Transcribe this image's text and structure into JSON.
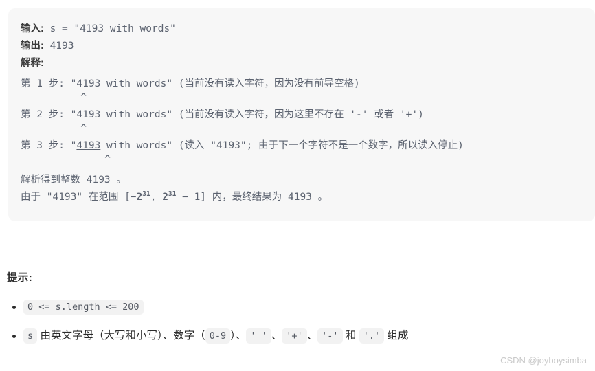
{
  "example": {
    "input_label": "输入:",
    "input_value": "s = \"4193 with words\"",
    "output_label": "输出:",
    "output_value": "4193",
    "explain_label": "解释:",
    "steps": [
      {
        "prefix": "第 1 步: \"",
        "highlight": "4193",
        "underlined": false,
        "suffix": " with words\" (当前没有读入字符，因为没有前导空格)",
        "caret": "          ^"
      },
      {
        "prefix": "第 2 步: \"",
        "highlight": "4193",
        "underlined": false,
        "suffix": " with words\" (当前没有读入字符，因为这里不存在 '-' 或者 '+')",
        "caret": "          ^"
      },
      {
        "prefix": "第 3 步: \"",
        "highlight": "4193",
        "underlined": true,
        "suffix": " with words\" (读入 \"4193\"; 由于下一个字符不是一个数字，所以读入停止)",
        "caret": "              ^"
      }
    ],
    "result_line": "解析得到整数 4193 。",
    "range_line": {
      "before": "由于 \"4193\" 在范围 [−",
      "base1": "2",
      "exp1": "31",
      "middle": ", ",
      "base2": "2",
      "exp2": "31",
      "after": " − 1] 内，最终结果为 4193 。"
    }
  },
  "hints": {
    "title": "提示:",
    "items": [
      {
        "kind": "code_only",
        "code": "0 <= s.length <= 200"
      },
      {
        "kind": "mixed",
        "parts": [
          {
            "type": "code",
            "text": "s"
          },
          {
            "type": "text",
            "text": " 由英文字母（大写和小写）、数字（"
          },
          {
            "type": "code",
            "text": "0-9"
          },
          {
            "type": "text",
            "text": "）、"
          },
          {
            "type": "code",
            "text": "' '"
          },
          {
            "type": "text",
            "text": "、"
          },
          {
            "type": "code",
            "text": "'+'"
          },
          {
            "type": "text",
            "text": "、"
          },
          {
            "type": "code",
            "text": "'-'"
          },
          {
            "type": "text",
            "text": " 和 "
          },
          {
            "type": "code",
            "text": "'.'"
          },
          {
            "type": "text",
            "text": " 组成"
          }
        ]
      }
    ]
  },
  "watermark": "CSDN @joyboysimba",
  "colors": {
    "panel_bg": "#f7f7f7",
    "text": "#2b2b2b",
    "mono_text": "#5c6370",
    "chip_bg": "#f2f2f2",
    "watermark": "#c9c9c9"
  }
}
